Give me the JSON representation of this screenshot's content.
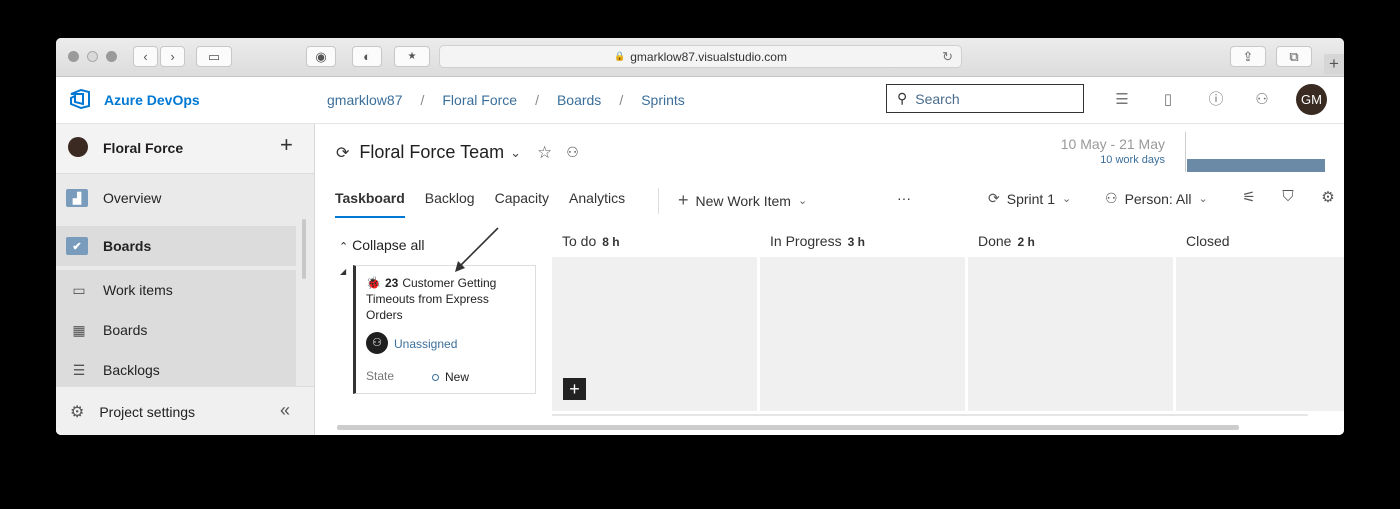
{
  "browser": {
    "url": "gmarklow87.visualstudio.com"
  },
  "header": {
    "brand": "Azure DevOps",
    "breadcrumb": [
      "gmarklow87",
      "Floral Force",
      "Boards",
      "Sprints"
    ],
    "breadcrumb_separator": "/",
    "search_placeholder": "Search",
    "avatar_initials": "GM"
  },
  "sidebar": {
    "project_name": "Floral Force",
    "items": [
      {
        "label": "Overview",
        "icon": "overview-icon"
      },
      {
        "label": "Boards",
        "icon": "boards-hub-icon"
      },
      {
        "label": "Work items",
        "icon": "work-items-icon"
      },
      {
        "label": "Boards",
        "icon": "boards-icon"
      },
      {
        "label": "Backlogs",
        "icon": "backlogs-icon"
      }
    ],
    "settings_label": "Project settings"
  },
  "main": {
    "team_name": "Floral Force Team",
    "date_range": "10 May - 21 May",
    "work_days": "10 work days",
    "tabs": [
      "Taskboard",
      "Backlog",
      "Capacity",
      "Analytics"
    ],
    "new_work_item": "New Work Item",
    "more": "···",
    "sprint": "Sprint 1",
    "person": "Person: All",
    "collapse_all": "Collapse all",
    "columns": [
      {
        "name": "To do",
        "hours": "8 h"
      },
      {
        "name": "In Progress",
        "hours": "3 h"
      },
      {
        "name": "Done",
        "hours": "2 h"
      },
      {
        "name": "Closed",
        "hours": ""
      }
    ],
    "card": {
      "id": "23",
      "title": "Customer Getting Timeouts from Express Orders",
      "assignee": "Unassigned",
      "state_label": "State",
      "state_value": "New"
    }
  },
  "colors": {
    "accent": "#0078d4",
    "link": "#3b6f9b",
    "burndown": "#6a8aa6"
  }
}
